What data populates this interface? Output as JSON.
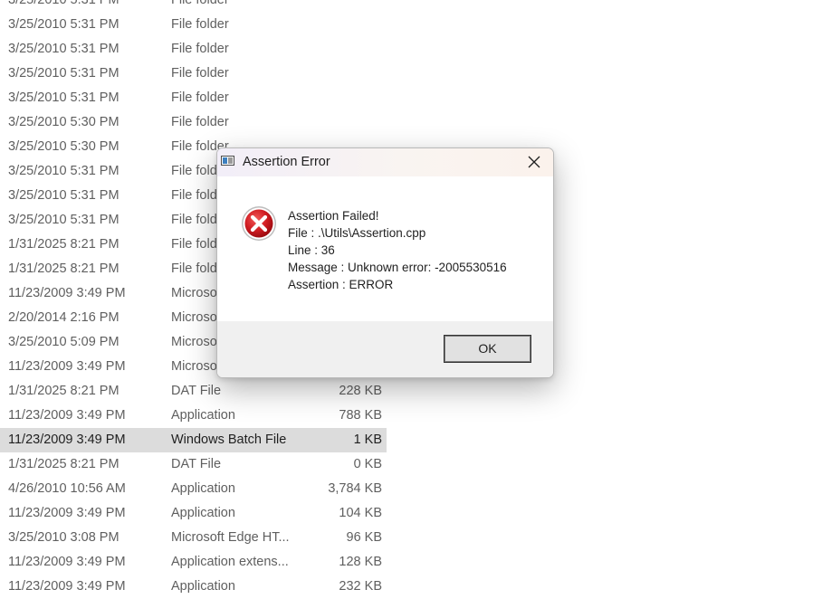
{
  "file_list": {
    "rows": [
      {
        "date": "3/25/2010 5:31 PM",
        "type": "File folder",
        "size": ""
      },
      {
        "date": "3/25/2010 5:31 PM",
        "type": "File folder",
        "size": ""
      },
      {
        "date": "3/25/2010 5:31 PM",
        "type": "File folder",
        "size": ""
      },
      {
        "date": "3/25/2010 5:31 PM",
        "type": "File folder",
        "size": ""
      },
      {
        "date": "3/25/2010 5:31 PM",
        "type": "File folder",
        "size": ""
      },
      {
        "date": "3/25/2010 5:30 PM",
        "type": "File folder",
        "size": ""
      },
      {
        "date": "3/25/2010 5:30 PM",
        "type": "File folder",
        "size": ""
      },
      {
        "date": "3/25/2010 5:31 PM",
        "type": "File folder",
        "size": ""
      },
      {
        "date": "3/25/2010 5:31 PM",
        "type": "File folder",
        "size": ""
      },
      {
        "date": "3/25/2010 5:31 PM",
        "type": "File folder",
        "size": ""
      },
      {
        "date": "1/31/2025 8:21 PM",
        "type": "File folder",
        "size": ""
      },
      {
        "date": "1/31/2025 8:21 PM",
        "type": "File folder",
        "size": ""
      },
      {
        "date": "11/23/2009 3:49 PM",
        "type": "Microsoft",
        "size": ""
      },
      {
        "date": "2/20/2014 2:16 PM",
        "type": "Microsoft",
        "size": ""
      },
      {
        "date": "3/25/2010 5:09 PM",
        "type": "Microsoft",
        "size": ""
      },
      {
        "date": "11/23/2009 3:49 PM",
        "type": "Microsoft",
        "size": ""
      },
      {
        "date": "1/31/2025 8:21 PM",
        "type": "DAT File",
        "size": "228 KB"
      },
      {
        "date": "11/23/2009 3:49 PM",
        "type": "Application",
        "size": "788 KB"
      },
      {
        "date": "11/23/2009 3:49 PM",
        "type": "Windows Batch File",
        "size": "1 KB",
        "selected": true
      },
      {
        "date": "1/31/2025 8:21 PM",
        "type": "DAT File",
        "size": "0 KB"
      },
      {
        "date": "4/26/2010 10:56 AM",
        "type": "Application",
        "size": "3,784 KB"
      },
      {
        "date": "11/23/2009 3:49 PM",
        "type": "Application",
        "size": "104 KB"
      },
      {
        "date": "3/25/2010 3:08 PM",
        "type": "Microsoft Edge HT...",
        "size": "96 KB"
      },
      {
        "date": "11/23/2009 3:49 PM",
        "type": "Application extens...",
        "size": "128 KB"
      },
      {
        "date": "11/23/2009 3:49 PM",
        "type": "Application",
        "size": "232 KB"
      }
    ]
  },
  "dialog": {
    "title": "Assertion Error",
    "icon": "error-icon",
    "message_lines": [
      "Assertion Failed!",
      "File : .\\Utils\\Assertion.cpp",
      "Line : 36",
      "Message : Unknown error: -2005530516",
      "Assertion : ERROR"
    ],
    "ok_label": "OK"
  },
  "colors": {
    "selected_row": "#dcdcdc",
    "error_red": "#c9141b",
    "dialog_footer": "#f0f0f0"
  }
}
